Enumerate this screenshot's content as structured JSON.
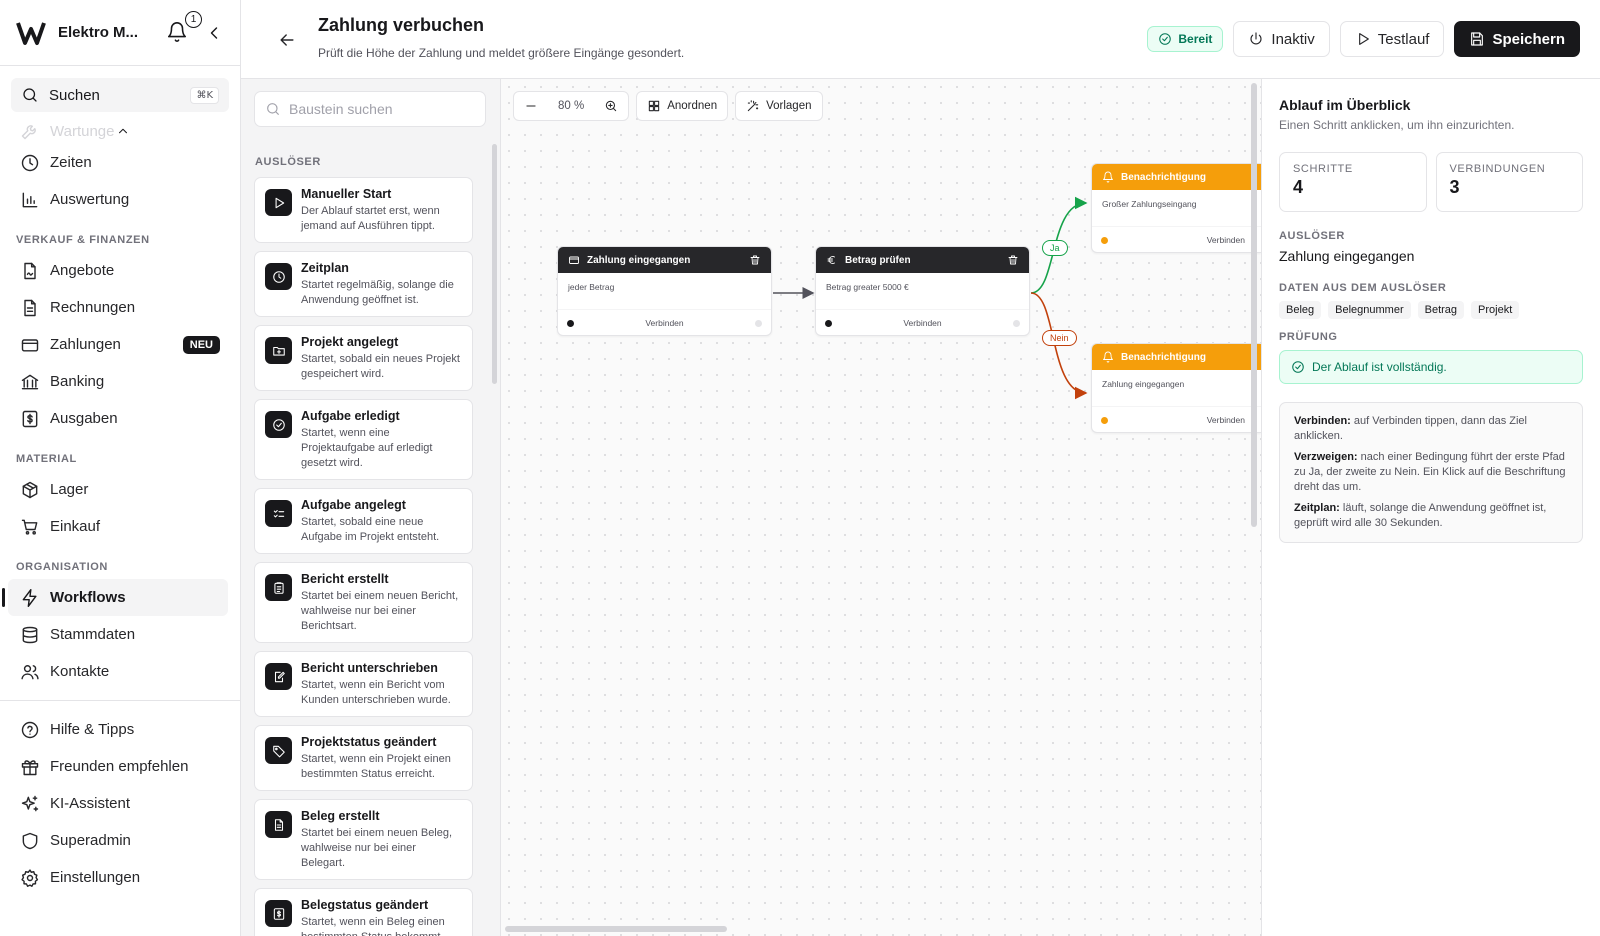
{
  "sidebar": {
    "company": "Elektro M...",
    "notifications": "1",
    "search": {
      "label": "Suchen",
      "shortcut": "⌘K"
    },
    "faded_item": "Wartunge",
    "top_items": [
      {
        "label": "Zeiten"
      },
      {
        "label": "Auswertung"
      }
    ],
    "sections": [
      {
        "title": "VERKAUF & FINANZEN",
        "items": [
          {
            "label": "Angebote"
          },
          {
            "label": "Rechnungen"
          },
          {
            "label": "Zahlungen",
            "badge": "NEU"
          },
          {
            "label": "Banking"
          },
          {
            "label": "Ausgaben"
          }
        ]
      },
      {
        "title": "MATERIAL",
        "items": [
          {
            "label": "Lager"
          },
          {
            "label": "Einkauf"
          }
        ]
      },
      {
        "title": "ORGANISATION",
        "items": [
          {
            "label": "Workflows"
          },
          {
            "label": "Stammdaten"
          },
          {
            "label": "Kontakte"
          }
        ]
      }
    ],
    "bottom_items": [
      {
        "label": "Hilfe & Tipps"
      },
      {
        "label": "Freunden empfehlen"
      },
      {
        "label": "KI-Assistent"
      },
      {
        "label": "Superadmin"
      },
      {
        "label": "Einstellungen"
      }
    ]
  },
  "header": {
    "title": "Zahlung verbuchen",
    "subtitle": "Prüft die Höhe der Zahlung und meldet größere Eingänge gesondert.",
    "status": "Bereit",
    "inactive": "Inaktiv",
    "test": "Testlauf",
    "save": "Speichern"
  },
  "palette": {
    "search_placeholder": "Baustein suchen",
    "section": "AUSLÖSER",
    "cards": [
      {
        "title": "Manueller Start",
        "desc": "Der Ablauf startet erst, wenn jemand auf Ausführen tippt.",
        "icon": "play-icon"
      },
      {
        "title": "Zeitplan",
        "desc": "Startet regelmäßig, solange die Anwendung geöffnet ist.",
        "icon": "clock-icon"
      },
      {
        "title": "Projekt angelegt",
        "desc": "Startet, sobald ein neues Projekt gespeichert wird.",
        "icon": "folder-plus-icon"
      },
      {
        "title": "Aufgabe erledigt",
        "desc": "Startet, wenn eine Projektaufgabe auf erledigt gesetzt wird.",
        "icon": "check-circle-icon"
      },
      {
        "title": "Aufgabe angelegt",
        "desc": "Startet, sobald eine neue Aufgabe im Projekt entsteht.",
        "icon": "list-check-icon"
      },
      {
        "title": "Bericht erstellt",
        "desc": "Startet bei einem neuen Bericht, wahlweise nur bei einer Berichtsart.",
        "icon": "clipboard-icon"
      },
      {
        "title": "Bericht unterschrieben",
        "desc": "Startet, wenn ein Bericht vom Kunden unterschrieben wurde.",
        "icon": "signature-icon"
      },
      {
        "title": "Projektstatus geändert",
        "desc": "Startet, wenn ein Projekt einen bestimmten Status erreicht.",
        "icon": "tag-icon"
      },
      {
        "title": "Beleg erstellt",
        "desc": "Startet bei einem neuen Beleg, wahlweise nur bei einer Belegart.",
        "icon": "document-icon"
      },
      {
        "title": "Belegstatus geändert",
        "desc": "Startet, wenn ein Beleg einen bestimmten Status bekommt.",
        "icon": "receipt-icon"
      }
    ]
  },
  "canvas": {
    "zoom": "80 %",
    "arrange": "Anordnen",
    "templates": "Vorlagen",
    "nodes": {
      "trigger": {
        "title": "Zahlung eingegangen",
        "body": "jeder Betrag",
        "connect": "Verbinden"
      },
      "check": {
        "title": "Betrag prüfen",
        "body": "Betrag greater 5000 €",
        "connect": "Verbinden"
      },
      "notify_yes": {
        "title": "Benachrichtigung",
        "body": "Großer Zahlungseingang",
        "connect": "Verbinden"
      },
      "notify_no": {
        "title": "Benachrichtigung",
        "body": "Zahlung eingegangen",
        "connect": "Verbinden"
      }
    },
    "edges": {
      "yes": "Ja",
      "no": "Nein"
    },
    "colors": {
      "yes": "#16a34a",
      "no": "#c2410c",
      "notify": "#f59e0b"
    }
  },
  "panel": {
    "title": "Ablauf im Überblick",
    "subtitle": "Einen Schritt anklicken, um ihn einzurichten.",
    "steps_label": "SCHRITTE",
    "steps_value": "4",
    "connections_label": "VERBINDUNGEN",
    "connections_value": "3",
    "trigger_label": "AUSLÖSER",
    "trigger_value": "Zahlung eingegangen",
    "data_label": "DATEN AUS DEM AUSLÖSER",
    "chips": [
      "Beleg",
      "Belegnummer",
      "Betrag",
      "Projekt"
    ],
    "check_label": "PRÜFUNG",
    "check_value": "Der Ablauf ist vollständig.",
    "help": [
      {
        "term": "Verbinden:",
        "text": "auf Verbinden tippen, dann das Ziel anklicken."
      },
      {
        "term": "Verzweigen:",
        "text": "nach einer Bedingung führt der erste Pfad zu Ja, der zweite zu Nein. Ein Klick auf die Beschriftung dreht das um."
      },
      {
        "term": "Zeitplan:",
        "text": "läuft, solange die Anwendung geöffnet ist, geprüft wird alle 30 Sekunden."
      }
    ]
  }
}
